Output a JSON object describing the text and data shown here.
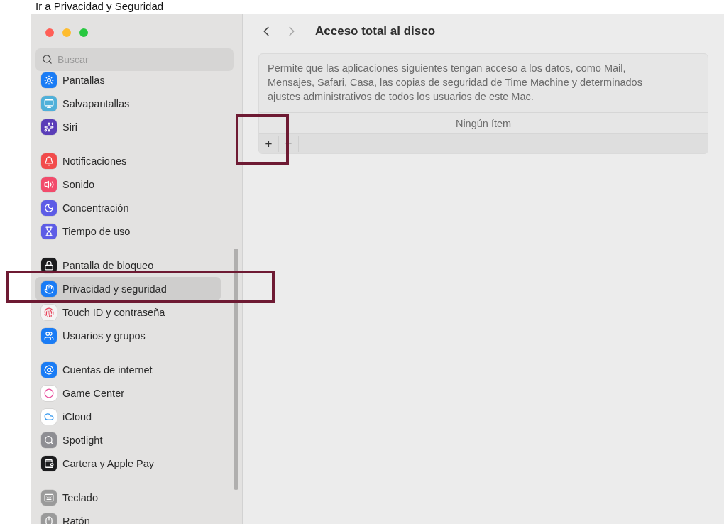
{
  "caption": "Ir a Privacidad y Seguridad",
  "sidebar": {
    "search": {
      "placeholder": "Buscar"
    },
    "groups": [
      {
        "items": [
          {
            "label": "Pantallas",
            "selected": false,
            "color": "#1a7cf5"
          },
          {
            "label": "Salvapantallas",
            "selected": false,
            "color": "#4fb0d9"
          },
          {
            "label": "Siri",
            "selected": false,
            "color": "#5a3db8"
          }
        ]
      },
      {
        "items": [
          {
            "label": "Notificaciones",
            "selected": false,
            "color": "#f24b4b"
          },
          {
            "label": "Sonido",
            "selected": false,
            "color": "#f24b6b"
          },
          {
            "label": "Concentración",
            "selected": false,
            "color": "#5d5ce6"
          },
          {
            "label": "Tiempo de uso",
            "selected": false,
            "color": "#5d5ce6"
          }
        ]
      },
      {
        "items": [
          {
            "label": "Pantalla de bloqueo",
            "selected": false,
            "color": "#1c1c1e"
          },
          {
            "label": "Privacidad y seguridad",
            "selected": true,
            "color": "#1a7cf5"
          },
          {
            "label": "Touch ID y contraseña",
            "selected": false,
            "color": "#f4f4f4"
          },
          {
            "label": "Usuarios y grupos",
            "selected": false,
            "color": "#1a7cf5"
          }
        ]
      },
      {
        "items": [
          {
            "label": "Cuentas de internet",
            "selected": false,
            "color": "#1a7cf5"
          },
          {
            "label": "Game Center",
            "selected": false,
            "color": "#ffffff"
          },
          {
            "label": "iCloud",
            "selected": false,
            "color": "#ffffff"
          },
          {
            "label": "Spotlight",
            "selected": false,
            "color": "#8e8e93"
          },
          {
            "label": "Cartera y Apple Pay",
            "selected": false,
            "color": "#1c1c1e"
          }
        ]
      },
      {
        "items": [
          {
            "label": "Teclado",
            "selected": false,
            "color": "#9a9a9a"
          },
          {
            "label": "Ratón",
            "selected": false,
            "color": "#9a9a9a"
          }
        ]
      }
    ]
  },
  "main": {
    "back": {
      "disabled": false
    },
    "forward": {
      "disabled": true
    },
    "title": "Acceso total al disco",
    "description": "Permite que las aplicaciones siguientes tengan acceso a los datos, como Mail, Mensajes, Safari, Casa, las copias de seguridad de Time Machine y determinados ajustes administrativos de todos los usuarios de este Mac.",
    "empty_text": "Ningún ítem",
    "buttons": [
      {
        "label": "+",
        "disabled": false
      },
      {
        "label": "−",
        "disabled": true
      }
    ]
  }
}
